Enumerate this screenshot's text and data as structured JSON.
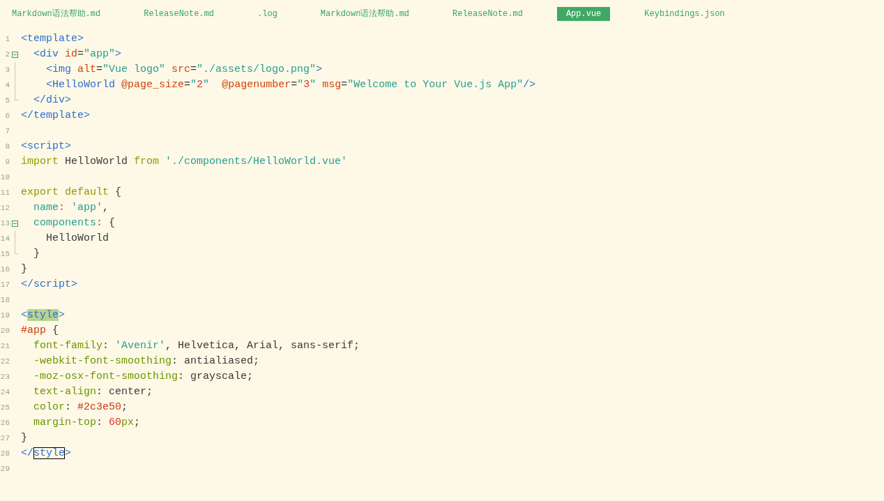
{
  "tabs": [
    {
      "label": "Markdown语法帮助.md",
      "selected": false
    },
    {
      "label": "ReleaseNote.md",
      "selected": false
    },
    {
      "label": ".log",
      "selected": false
    },
    {
      "label": "Markdown语法帮助.md",
      "selected": false
    },
    {
      "label": "ReleaseNote.md",
      "selected": false
    },
    {
      "label": "App.vue",
      "selected": true
    },
    {
      "label": "Keybindings.json",
      "selected": false
    }
  ],
  "editor": {
    "lines": [
      {
        "number": "1",
        "kind": "plain",
        "tokens": [
          {
            "kind": "tag",
            "text": "<template>"
          }
        ]
      },
      {
        "number": "2",
        "kind": "foldstart",
        "tokens": [
          {
            "kind": "tag",
            "text": "  <div"
          },
          {
            "kind": "attr",
            "text": " id"
          },
          {
            "kind": "plain",
            "text": "="
          },
          {
            "kind": "string",
            "text": "\"app\""
          },
          {
            "kind": "tag",
            "text": ">"
          }
        ]
      },
      {
        "number": "3",
        "kind": "foldinside",
        "tokens": [
          {
            "kind": "tag",
            "text": "    <img"
          },
          {
            "kind": "attr",
            "text": " alt"
          },
          {
            "kind": "plain",
            "text": "="
          },
          {
            "kind": "string",
            "text": "\"Vue logo\""
          },
          {
            "kind": "attr",
            "text": " src"
          },
          {
            "kind": "plain",
            "text": "="
          },
          {
            "kind": "string",
            "text": "\"./assets/logo.png\""
          },
          {
            "kind": "tag",
            "text": ">"
          }
        ]
      },
      {
        "number": "4",
        "kind": "foldinside",
        "tokens": [
          {
            "kind": "tag",
            "text": "    <HelloWorld"
          },
          {
            "kind": "attr",
            "text": " @page_size"
          },
          {
            "kind": "plain",
            "text": "="
          },
          {
            "kind": "string",
            "text": "\""
          },
          {
            "kind": "number",
            "text": "2"
          },
          {
            "kind": "string",
            "text": "\""
          },
          {
            "kind": "attr",
            "text": "  @pagenumber"
          },
          {
            "kind": "plain",
            "text": "="
          },
          {
            "kind": "string",
            "text": "\""
          },
          {
            "kind": "number",
            "text": "3"
          },
          {
            "kind": "string",
            "text": "\""
          },
          {
            "kind": "attr",
            "text": " msg"
          },
          {
            "kind": "plain",
            "text": "="
          },
          {
            "kind": "string",
            "text": "\"Welcome to Your Vue.js App\""
          },
          {
            "kind": "tag",
            "text": "/>"
          }
        ]
      },
      {
        "number": "5",
        "kind": "foldend",
        "tokens": [
          {
            "kind": "tag",
            "text": "  </div>"
          }
        ]
      },
      {
        "number": "6",
        "kind": "plain",
        "tokens": [
          {
            "kind": "tag",
            "text": "</template>"
          }
        ]
      },
      {
        "number": "7",
        "kind": "plain"
      },
      {
        "number": "8",
        "kind": "plain",
        "tokens": [
          {
            "kind": "tag",
            "text": "<script>"
          }
        ]
      },
      {
        "number": "9",
        "kind": "plain",
        "tokens": [
          {
            "kind": "keyword",
            "text": "import"
          },
          {
            "kind": "plain",
            "text": " HelloWorld "
          },
          {
            "kind": "keyword",
            "text": "from"
          },
          {
            "kind": "string",
            "text": " './components/HelloWorld.vue'"
          }
        ]
      },
      {
        "number": "10",
        "kind": "plain"
      },
      {
        "number": "11",
        "kind": "plain",
        "tokens": [
          {
            "kind": "keyword",
            "text": "export default"
          },
          {
            "kind": "plain",
            "text": " {"
          }
        ]
      },
      {
        "number": "12",
        "kind": "plain",
        "tokens": [
          {
            "kind": "key",
            "text": "  name"
          },
          {
            "kind": "colon",
            "text": ":"
          },
          {
            "kind": "string",
            "text": " 'app'"
          },
          {
            "kind": "plain",
            "text": ","
          }
        ]
      },
      {
        "number": "13",
        "kind": "foldstart",
        "tokens": [
          {
            "kind": "key",
            "text": "  components"
          },
          {
            "kind": "colon",
            "text": ":"
          },
          {
            "kind": "plain",
            "text": " {"
          }
        ]
      },
      {
        "number": "14",
        "kind": "foldinside",
        "tokens": [
          {
            "kind": "plain",
            "text": "    HelloWorld"
          }
        ]
      },
      {
        "number": "15",
        "kind": "foldend",
        "tokens": [
          {
            "kind": "plain",
            "text": "  }"
          }
        ]
      },
      {
        "number": "16",
        "kind": "plain",
        "tokens": [
          {
            "kind": "plain",
            "text": "}"
          }
        ]
      },
      {
        "number": "17",
        "kind": "plain",
        "tokens": [
          {
            "kind": "tag",
            "text": "</script>"
          }
        ]
      },
      {
        "number": "18",
        "kind": "plain"
      },
      {
        "number": "19",
        "kind": "plain",
        "tokens": [
          {
            "kind": "tag",
            "text": "<"
          },
          {
            "kind": "tagmatch",
            "text": "style"
          },
          {
            "kind": "tag",
            "text": ">"
          }
        ]
      },
      {
        "number": "20",
        "kind": "plain",
        "tokens": [
          {
            "kind": "selector",
            "text": "#app"
          },
          {
            "kind": "plain",
            "text": " {"
          }
        ]
      },
      {
        "number": "21",
        "kind": "plain",
        "tokens": [
          {
            "kind": "property",
            "text": "  font-family"
          },
          {
            "kind": "plain",
            "text": ": "
          },
          {
            "kind": "string",
            "text": "'Avenir'"
          },
          {
            "kind": "plain",
            "text": ", Helvetica, Arial, sans-serif;"
          }
        ]
      },
      {
        "number": "22",
        "kind": "plain",
        "tokens": [
          {
            "kind": "property",
            "text": "  -webkit-font-smoothing"
          },
          {
            "kind": "plain",
            "text": ": antialiased;"
          }
        ]
      },
      {
        "number": "23",
        "kind": "plain",
        "tokens": [
          {
            "kind": "property",
            "text": "  -moz-osx-font-smoothing"
          },
          {
            "kind": "plain",
            "text": ": grayscale;"
          }
        ]
      },
      {
        "number": "24",
        "kind": "plain",
        "tokens": [
          {
            "kind": "property",
            "text": "  text-align"
          },
          {
            "kind": "plain",
            "text": ": center;"
          }
        ]
      },
      {
        "number": "25",
        "kind": "plain",
        "tokens": [
          {
            "kind": "property",
            "text": "  color"
          },
          {
            "kind": "plain",
            "text": ": "
          },
          {
            "kind": "selector",
            "text": "#2c3e50"
          },
          {
            "kind": "plain",
            "text": ";"
          }
        ]
      },
      {
        "number": "26",
        "kind": "plain",
        "tokens": [
          {
            "kind": "property",
            "text": "  margin-top"
          },
          {
            "kind": "plain",
            "text": ": "
          },
          {
            "kind": "number",
            "text": "60"
          },
          {
            "kind": "property",
            "text": "px"
          },
          {
            "kind": "plain",
            "text": ";"
          }
        ]
      },
      {
        "number": "27",
        "kind": "plain",
        "tokens": [
          {
            "kind": "plain",
            "text": "}"
          }
        ]
      },
      {
        "number": "28",
        "kind": "plain",
        "tokens": [
          {
            "kind": "tag",
            "text": "</"
          },
          {
            "kind": "tagboxed",
            "text": "style"
          },
          {
            "kind": "tag",
            "text": ">"
          }
        ]
      },
      {
        "number": "29",
        "kind": "plain"
      }
    ]
  }
}
